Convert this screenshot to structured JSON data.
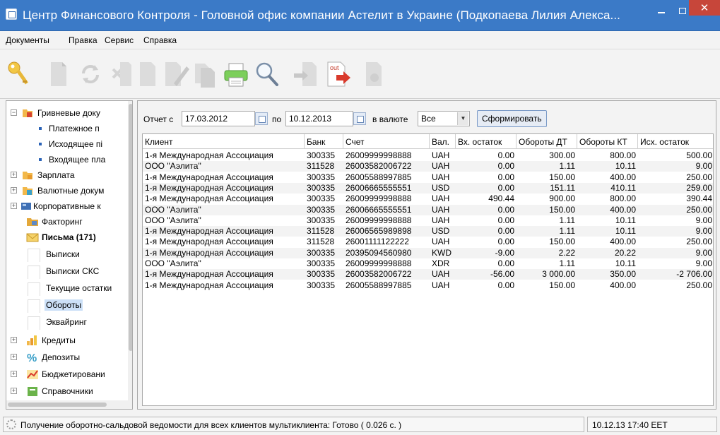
{
  "window": {
    "title": "Центр Финансового Контроля - Головной офис компании Астелит в Украине (Подкопаева Лилия Алекса...",
    "minimize_icon": "minimize-icon",
    "maximize_icon": "maximize-icon",
    "close_icon": "close-icon",
    "close_glyph": "✕"
  },
  "menu": {
    "items": [
      "Документы",
      "Правка",
      "Сервис",
      "Справка"
    ]
  },
  "toolbar": {
    "icons": [
      "key-icon",
      "document-icon",
      "refresh-icon",
      "delete-icon",
      "document-icon",
      "edit-icon",
      "copy-icon",
      "printer-icon",
      "search-icon",
      "import-icon",
      "export-out-icon",
      "sign-icon"
    ],
    "out_label": "out"
  },
  "tree": {
    "items": [
      {
        "label": "Гривневые доку",
        "icon": "folder-uah-icon",
        "expander": "−"
      },
      {
        "label": "Платежное п"
      },
      {
        "label": "Исходящее пі"
      },
      {
        "label": "Входящее пла"
      },
      {
        "label": "Зарплата",
        "icon": "folder-salary-icon",
        "expander": "+"
      },
      {
        "label": "Валютные докум",
        "icon": "folder-currency-icon",
        "expander": "+"
      },
      {
        "label": "Корпоративные к",
        "icon": "corporate-cards-icon",
        "expander": "+"
      },
      {
        "label": "Факторинг",
        "icon": "factoring-icon"
      },
      {
        "label": "Письма (171)",
        "icon": "envelope-icon"
      },
      {
        "label": "Выписки"
      },
      {
        "label": "Выписки СКС"
      },
      {
        "label": "Текущие остатки"
      },
      {
        "label": "Обороты"
      },
      {
        "label": "Эквайринг"
      },
      {
        "label": "Кредиты",
        "icon": "credits-icon",
        "expander": "+"
      },
      {
        "label": "Депозиты",
        "icon": "percent-icon",
        "expander": "+"
      },
      {
        "label": "Бюджетировани",
        "icon": "budget-chart-icon",
        "expander": "+"
      },
      {
        "label": "Справочники",
        "icon": "reference-icon",
        "expander": "+"
      }
    ]
  },
  "filter": {
    "report_from_label": "Отчет с",
    "date_from": "17.03.2012",
    "to_label": "по",
    "date_to": "10.12.2013",
    "currency_label": "в валюте",
    "currency_value": "Все",
    "generate_button": "Сформировать"
  },
  "table": {
    "columns": [
      "Клиент",
      "Банк",
      "Счет",
      "Вал.",
      "Вх. остаток",
      "Обороты ДТ",
      "Обороты КТ",
      "Исх. остаток"
    ],
    "rows": [
      [
        "1-я Международная Ассоциация",
        "300335",
        "26009999998888",
        "UAH",
        "0.00",
        "300.00",
        "800.00",
        "500.00"
      ],
      [
        "ООО \"Аэлита\"",
        "311528",
        "26003582006722",
        "UAH",
        "0.00",
        "1.11",
        "10.11",
        "9.00"
      ],
      [
        "1-я Международная Ассоциация",
        "300335",
        "26005588997885",
        "UAH",
        "0.00",
        "150.00",
        "400.00",
        "250.00"
      ],
      [
        "1-я Международная Ассоциация",
        "300335",
        "26006665555551",
        "USD",
        "0.00",
        "151.11",
        "410.11",
        "259.00"
      ],
      [
        "1-я Международная Ассоциация",
        "300335",
        "26009999998888",
        "UAH",
        "490.44",
        "900.00",
        "800.00",
        "390.44"
      ],
      [
        "ООО \"Аэлита\"",
        "300335",
        "26006665555551",
        "UAH",
        "0.00",
        "150.00",
        "400.00",
        "250.00"
      ],
      [
        "ООО \"Аэлита\"",
        "300335",
        "26009999998888",
        "UAH",
        "0.00",
        "1.11",
        "10.11",
        "9.00"
      ],
      [
        "1-я Международная Ассоциация",
        "311528",
        "26006565989898",
        "USD",
        "0.00",
        "1.11",
        "10.11",
        "9.00"
      ],
      [
        "1-я Международная Ассоциация",
        "311528",
        "26001111122222",
        "UAH",
        "0.00",
        "150.00",
        "400.00",
        "250.00"
      ],
      [
        "1-я Международная Ассоциация",
        "300335",
        "20395094560980",
        "KWD",
        "-9.00",
        "2.22",
        "20.22",
        "9.00"
      ],
      [
        "ООО \"Аэлита\"",
        "300335",
        "26009999998888",
        "XDR",
        "0.00",
        "1.11",
        "10.11",
        "9.00"
      ],
      [
        "1-я Международная Ассоциация",
        "300335",
        "26003582006722",
        "UAH",
        "-56.00",
        "3 000.00",
        "350.00",
        "-2 706.00"
      ],
      [
        "1-я Международная Ассоциация",
        "300335",
        "26005588997885",
        "UAH",
        "0.00",
        "150.00",
        "400.00",
        "250.00"
      ]
    ]
  },
  "status": {
    "message": "Получение оборотно-сальдовой ведомости для всех клиентов мультиклиента: Готово ( 0.026 с. )",
    "datetime": "10.12.13 17:40 EET"
  },
  "colors": {
    "titlebar": "#3b7ac7",
    "close_button": "#c7463a",
    "selection": "#cce0f7"
  }
}
